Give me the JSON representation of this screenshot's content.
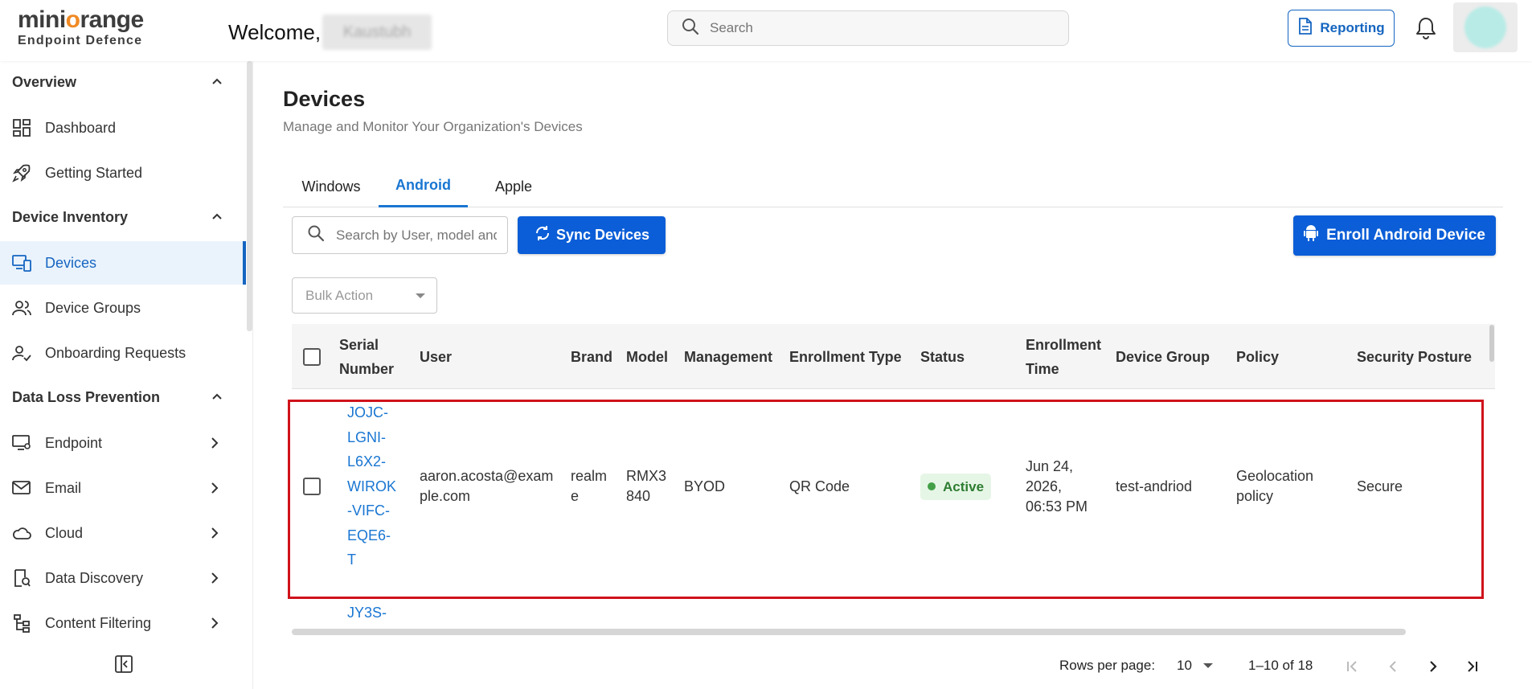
{
  "header": {
    "logo_main_pre": "mini",
    "logo_main_o": "o",
    "logo_main_post": "range",
    "logo_sub": "Endpoint Defence",
    "welcome": "Welcome,",
    "user_name": "Kaustubh",
    "search_placeholder": "Search",
    "reporting_label": "Reporting"
  },
  "sidebar": {
    "overview": "Overview",
    "dashboard": "Dashboard",
    "getting_started": "Getting Started",
    "device_inventory": "Device Inventory",
    "devices": "Devices",
    "device_groups": "Device Groups",
    "onboarding_requests": "Onboarding Requests",
    "data_loss_prevention": "Data Loss Prevention",
    "endpoint": "Endpoint",
    "email": "Email",
    "cloud": "Cloud",
    "data_discovery": "Data Discovery",
    "content_filtering": "Content Filtering"
  },
  "main": {
    "title": "Devices",
    "subtitle": "Manage and Monitor Your Organization's Devices",
    "tabs": [
      "Windows",
      "Android",
      "Apple"
    ],
    "active_tab": "Android",
    "search_placeholder": "Search by User, model and serial number",
    "sync_label": "Sync Devices",
    "enroll_label": "Enroll Android Device",
    "bulk_action": "Bulk Action"
  },
  "table": {
    "columns": {
      "serial_l1": "Serial",
      "serial_l2": "Number",
      "user": "User",
      "brand": "Brand",
      "model": "Model",
      "management": "Management",
      "enrollment_type": "Enrollment Type",
      "status": "Status",
      "enroll_time_l1": "Enrollment",
      "enroll_time_l2": "Time",
      "device_group": "Device Group",
      "policy": "Policy",
      "security_posture": "Security Posture"
    },
    "row1": {
      "serial_lines": [
        "JOJC-",
        "LGNI-",
        "L6X2-",
        "WIROK",
        "-VIFC-",
        "EQE6-",
        "T"
      ],
      "user_lines": [
        "aaron.acosta@exam",
        "ple.com"
      ],
      "brand_lines": [
        "realm",
        "e"
      ],
      "model_lines": [
        "RMX3",
        "840"
      ],
      "management": "BYOD",
      "enrollment_type": "QR Code",
      "status": "Active",
      "time_lines": [
        "Jun 24,",
        "2026,",
        "06:53 PM"
      ],
      "device_group": "test-andriod",
      "policy_lines": [
        "Geolocation",
        "policy"
      ],
      "security_posture": "Secure"
    },
    "row2": {
      "serial_partial": "JY3S-"
    }
  },
  "pagination": {
    "rows_per_page_label": "Rows per page:",
    "rows_per_page": "10",
    "range": "1–10 of 18"
  },
  "colors": {
    "primary": "#0b5ed7",
    "link": "#1976d2",
    "highlight": "#d0121b",
    "status_active": "#2e7d32",
    "logo_accent": "#f08a24"
  }
}
